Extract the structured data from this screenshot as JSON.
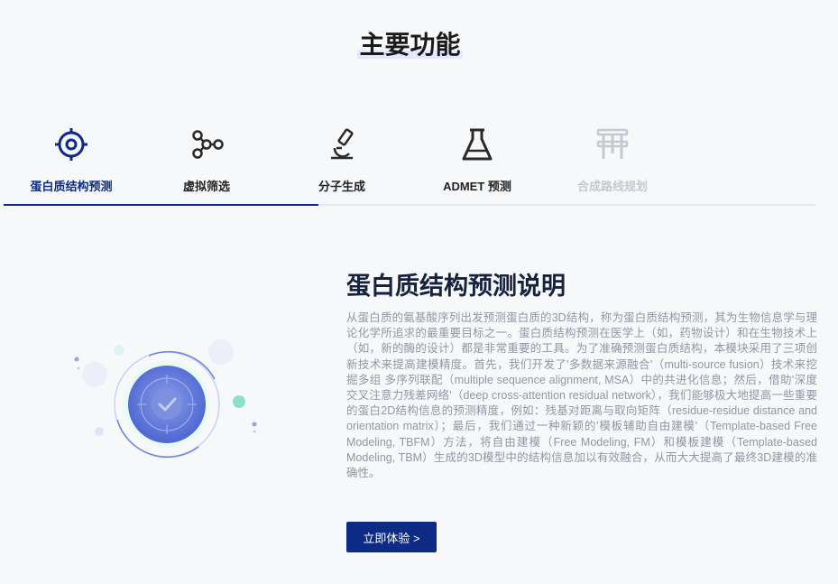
{
  "section_title": "主要功能",
  "tabs": [
    {
      "label": "蛋白质结构预测",
      "icon": "target-icon",
      "state": "active"
    },
    {
      "label": "虚拟筛选",
      "icon": "molecule-graph-icon",
      "state": "normal"
    },
    {
      "label": "分子生成",
      "icon": "microscope-icon",
      "state": "normal"
    },
    {
      "label": "ADMET 预测",
      "icon": "flask-icon",
      "state": "normal"
    },
    {
      "label": "合成路线规划",
      "icon": "pipeline-icon",
      "state": "disabled"
    }
  ],
  "description": {
    "title": "蛋白质结构预测说明",
    "body": "从蛋白质的氨基酸序列出发预测蛋白质的3D结构，称为蛋白质结构预测，其为生物信息学与理论化学所追求的最重要目标之一。蛋白质结构预测在医学上（如，药物设计）和在生物技术上（如，新的酶的设计）都是非常重要的工具。为了准确预测蛋白质结构，本模块采用了三项创新技术来提高建模精度。首先，我们开发了'多数据来源融合'（multi-source fusion）技术来挖掘多组 多序列联配（multiple sequence alignment, MSA）中的共进化信息；然后，借助'深度交叉注意力残差网络'（deep cross-attention residual network），我们能够极大地提高一些重要的蛋白2D结构信息的预测精度，例如：残基对距离与取向矩阵（residue-residue distance and orientation matrix）；最后，我们通过一种新颖的'模板辅助自由建模'（Template-based Free Modeling, TBFM）方法，将自由建模（Free Modeling, FM）和模板建模（Template-based Modeling, TBM）生成的3D模型中的结构信息加以有效融合，从而大大提高了最终3D建模的准确性。"
  },
  "cta_label": "立即体验 >",
  "colors": {
    "primary": "#0d2b85",
    "disabled": "#c4c8cf",
    "illustration": "#5b73d6"
  }
}
